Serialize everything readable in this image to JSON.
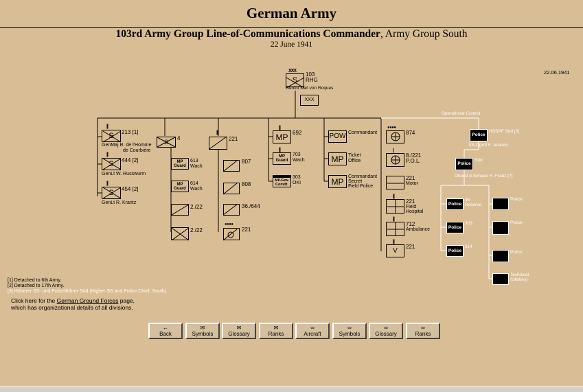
{
  "header": {
    "title": "German Army",
    "subtitle_bold": "103rd Army Group Line-of-Communications Commander",
    "subtitle_rest": ", Army Group South",
    "date": "22 June 1941",
    "corner_date": "22.06.1941"
  },
  "hq": {
    "echelon": "XXX",
    "number": "103",
    "type": "RHG",
    "commander": "GenInf Karl von Roques",
    "staff_echelon": "XXX",
    "symbol": "S"
  },
  "col1": {
    "echelon": "||",
    "units": [
      {
        "symbol": "S",
        "label": "213 [1]",
        "cmd1": "GenMaj R. de l'Homme",
        "cmd2": "de Courbière"
      },
      {
        "symbol": "S",
        "label": "444 [2]",
        "cmd1": "GenLt W. Russwurm"
      },
      {
        "symbol": "S",
        "label": "454 [2]",
        "cmd1": "GenLt R. Krantz"
      }
    ]
  },
  "col2": {
    "head": {
      "symbol": "S",
      "label": "4",
      "echelon": "|"
    },
    "units": [
      {
        "symbol": "MP Guard",
        "label1": "613",
        "label2": "Wach"
      },
      {
        "symbol": "MP Guard",
        "label1": "614",
        "label2": "Wach"
      },
      {
        "symbol": "",
        "label1": "2./22"
      },
      {
        "symbol": "",
        "label1": "2./22"
      }
    ]
  },
  "col3": {
    "head": {
      "label": "221",
      "echelon": "||"
    },
    "units": [
      {
        "label": "807"
      },
      {
        "label": "808"
      },
      {
        "label": "36./644"
      },
      {
        "label": "221"
      }
    ]
  },
  "col4": {
    "units": [
      {
        "symbol": "MP",
        "label1": "692"
      },
      {
        "symbol": "MP Guard",
        "label1": "703",
        "label2": "Wach"
      },
      {
        "symbol": "Mil.Gov. Comdt.",
        "label1": "303",
        "label2": "OKI"
      }
    ]
  },
  "col5": {
    "units": [
      {
        "symbol": "POW",
        "label1": "Commandant"
      },
      {
        "symbol": "MP",
        "label1": "Ticket",
        "label2": "Office"
      },
      {
        "symbol": "MP",
        "label1": "Commandant",
        "label2": "Secret",
        "label3": "Field Police"
      }
    ]
  },
  "col6": {
    "units": [
      {
        "label1": "874"
      },
      {
        "label1": "8./221",
        "label2": "P.O.L."
      },
      {
        "label1": "221",
        "label2": "Motor"
      },
      {
        "label1": "221",
        "label2": "Field",
        "label3": "Hospital"
      },
      {
        "label1": "712",
        "label2": "Ambulance"
      },
      {
        "symbol": "V",
        "label1": "221"
      }
    ]
  },
  "police": {
    "op_control": "Operational Control",
    "hsspf": {
      "symbol": "Police",
      "label": "HSSPF Süd [3]",
      "cmd": "SS-Ogruf F. Jeckeln"
    },
    "sud": {
      "symbol": "Police",
      "label": "Süd",
      "cmd": "Oberst d.Schupo H. Franz [?]"
    },
    "bns": [
      {
        "symbol": "Police",
        "label1": "45",
        "label2": "Reserve"
      },
      {
        "symbol": "Police",
        "label1": "303"
      },
      {
        "symbol": "Police",
        "label1": "314"
      }
    ],
    "coys": [
      {
        "label": "Police"
      },
      {
        "label": "Police"
      },
      {
        "label": "Police"
      },
      {
        "label1": "Technical",
        "label2": "(Utilities)"
      }
    ]
  },
  "notes": {
    "n1": "[1] Detached to 6th Army.",
    "n2": "[2] Detached to 17th Army.",
    "n3": "[3] Höherer SS- und Polizeiführer Süd (Higher SS and Police Chief, South)."
  },
  "click": {
    "pre": "Click here for the ",
    "link": "German Ground Forces",
    "post": " page,",
    "line2": "which has organizational details of all divisions."
  },
  "nav": [
    {
      "icon": "←",
      "label": "Back"
    },
    {
      "icon": "✉",
      "label": "Symbols"
    },
    {
      "icon": "✉",
      "label": "Glossary"
    },
    {
      "icon": "✉",
      "label": "Ranks"
    },
    {
      "icon": "∞",
      "label": "Aircraft"
    },
    {
      "icon": "∞",
      "label": "Symbols"
    },
    {
      "icon": "∞",
      "label": "Glossary"
    },
    {
      "icon": "∞",
      "label": "Ranks"
    }
  ]
}
